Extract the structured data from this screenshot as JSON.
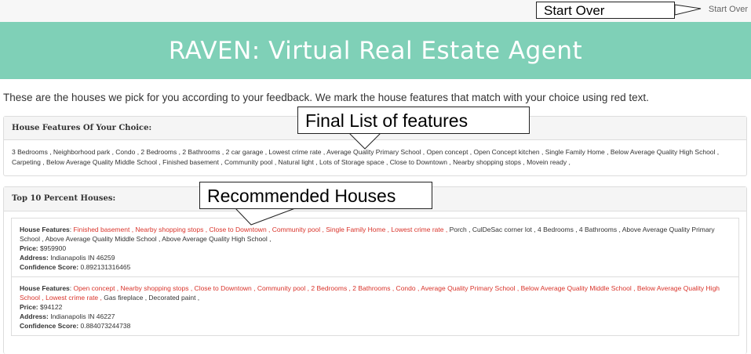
{
  "topbar": {
    "start_over_link": "Start Over"
  },
  "annotations": {
    "start_over": "Start Over",
    "final_list": "Final List of features",
    "recommended": "Recommended Houses"
  },
  "header": {
    "title": "RAVEN: Virtual Real Estate Agent"
  },
  "intro_text": "These are the houses we pick for you according to your feedback. We mark the house features that match with your choice using red text.",
  "features_panel": {
    "heading": "House Features Of Your Choice:",
    "features_text": "3 Bedrooms , Neighborhood park , Condo , 2 Bedrooms , 2 Bathrooms , 2 car garage , Lowest crime rate , Average Quality Primary School , Open concept , Open Concept kitchen , Single Family Home , Below Average Quality High School , Carpeting , Below Average Quality Middle School , Finished basement , Community pool , Natural light , Lots of Storage space , Close to Downtown , Nearby shopping stops , Movein ready ,"
  },
  "top_panel": {
    "heading": "Top 10 Percent Houses:",
    "labels": {
      "features": "House Features",
      "price": "Price:",
      "address": "Address:",
      "confidence": "Confidence Score:"
    },
    "houses": [
      {
        "matched_features": "Finished basement , Nearby shopping stops , Close to Downtown , Community pool , Single Family Home , Lowest crime rate ,",
        "other_features": " Porch , CulDeSac corner lot , 4 Bedrooms , 4 Bathrooms , Above Average Quality Primary School , Above Average Quality Middle School , Above Average Quality High School ,",
        "price": "$959900",
        "address": "Indianapolis IN 46259",
        "confidence": "0.892131316465"
      },
      {
        "matched_features": "Open concept , Nearby shopping stops , Close to Downtown , Community pool , 2 Bedrooms , 2 Bathrooms , Condo , Average Quality Primary School , Below Average Quality Middle School , Below Average Quality High School , Lowest crime rate ,",
        "other_features": " Gas fireplace , Decorated paint ,",
        "price": "$94122",
        "address": "Indianapolis IN 46227",
        "confidence": "0.884073244738"
      }
    ]
  },
  "colors": {
    "header_bg": "#7fd0b7",
    "match_red": "#d9342b"
  }
}
